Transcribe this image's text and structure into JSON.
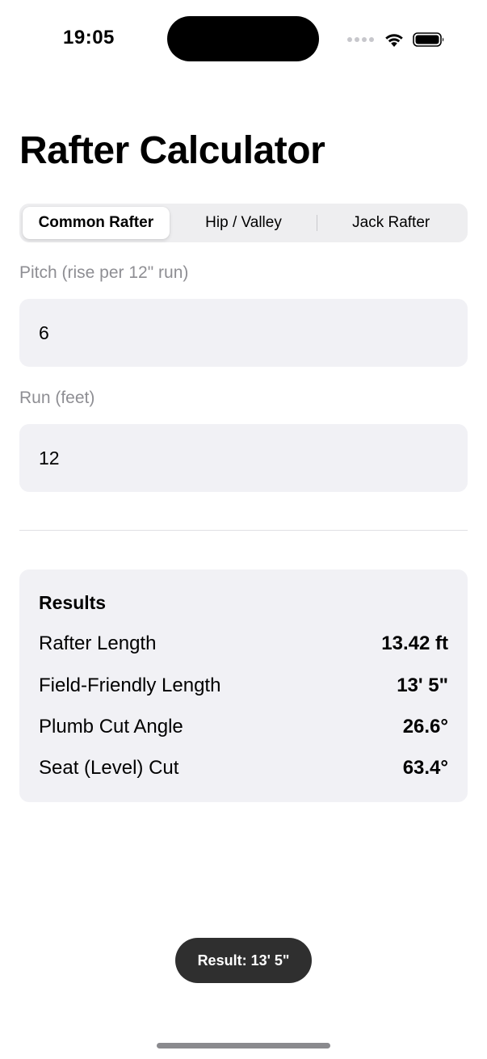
{
  "status_bar": {
    "time": "19:05",
    "icons": [
      "cellular-signal-icon",
      "wifi-icon",
      "battery-icon"
    ]
  },
  "title": "Rafter Calculator",
  "segments": [
    {
      "label": "Common Rafter",
      "selected": true
    },
    {
      "label": "Hip / Valley",
      "selected": false
    },
    {
      "label": "Jack Rafter",
      "selected": false
    }
  ],
  "fields": {
    "pitch": {
      "label": "Pitch (rise per 12\" run)",
      "value": "6"
    },
    "run": {
      "label": "Run (feet)",
      "value": "12"
    }
  },
  "results": {
    "title": "Results",
    "rows": [
      {
        "label": "Rafter Length",
        "value": "13.42 ft"
      },
      {
        "label": "Field-Friendly Length",
        "value": "13' 5\""
      },
      {
        "label": "Plumb Cut Angle",
        "value": "26.6°"
      },
      {
        "label": "Seat (Level) Cut",
        "value": "63.4°"
      }
    ]
  },
  "toast": "Result: 13' 5\"",
  "colors": {
    "field_background": "#f1f1f5",
    "secondary_text": "#8e8e93",
    "toast_background": "#2f2f2f"
  }
}
